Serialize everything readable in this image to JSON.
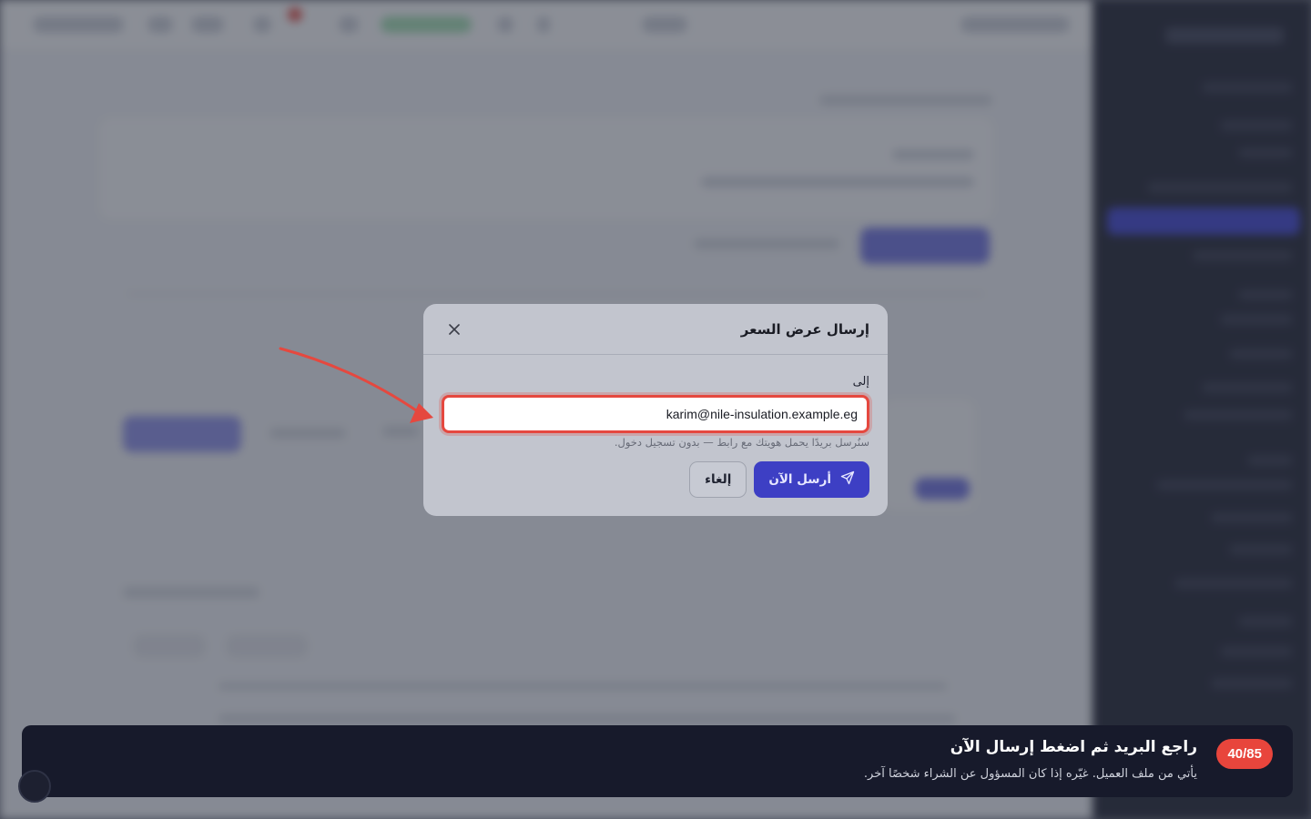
{
  "modal": {
    "title": "إرسال عرض السعر",
    "close_icon": "close-icon",
    "to_label": "إلى",
    "to_value": "karim@nile-insulation.example.eg",
    "hint": "سنُرسل بريدًا يحمل هويتك مع رابط — بدون تسجيل دخول.",
    "send_label": "أرسل الآن",
    "send_icon": "paper-plane-icon",
    "cancel_label": "إلغاء"
  },
  "tour": {
    "progress": "40/85",
    "title": "راجع البريد ثم اضغط إرسال الآن",
    "subtitle": "يأتي من ملف العميل. غيّره إذا كان المسؤول عن الشراء شخصًا آخر."
  },
  "colors": {
    "accent": "#3d3fc4",
    "highlight": "#e5483f",
    "tour_bg": "#171a2b"
  }
}
